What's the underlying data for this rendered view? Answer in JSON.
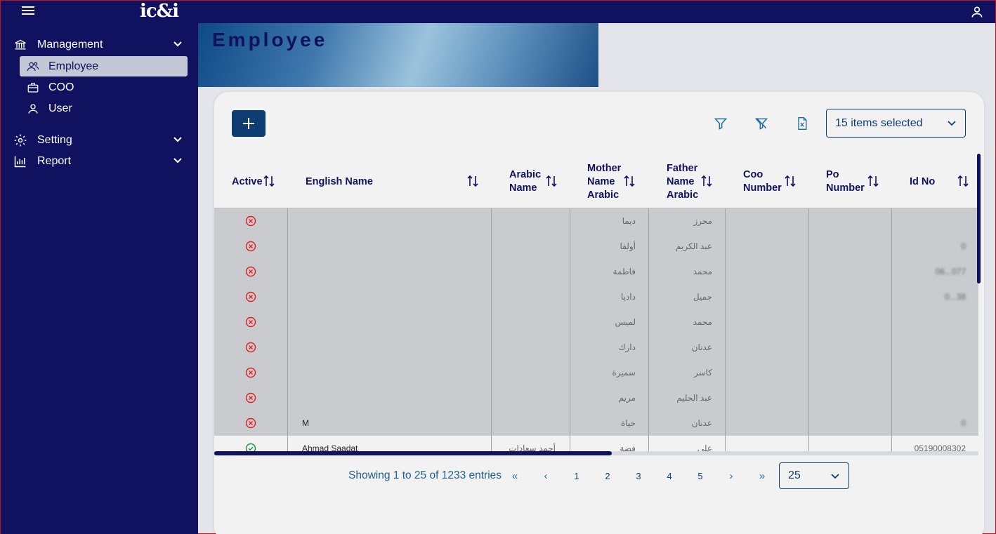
{
  "app": {
    "logo": "ic&i"
  },
  "sidebar": {
    "groups": [
      {
        "label": "Management",
        "items": [
          {
            "label": "Employee",
            "active": true
          },
          {
            "label": "COO"
          },
          {
            "label": "User"
          }
        ]
      },
      {
        "label": "Setting"
      },
      {
        "label": "Report"
      }
    ]
  },
  "page": {
    "title": "Employee"
  },
  "toolbar": {
    "columns_select": "15 items selected",
    "icons": [
      "filter-icon",
      "clear-filter-icon",
      "excel-export-icon"
    ]
  },
  "table": {
    "columns": [
      "Active",
      "English Name",
      "Arabic\nName",
      "Mother\nName\nArabic",
      "Father\nName\nArabic",
      "Coo\nNumber",
      "Po\nNumber",
      "Id No"
    ],
    "rows": [
      {
        "active": false,
        "english_name": "",
        "arabic_name": "",
        "mother": "ديما",
        "father": "محرز",
        "coo": "",
        "po": "",
        "id": ""
      },
      {
        "active": false,
        "english_name": "",
        "arabic_name": "",
        "mother": "أولفا",
        "father": "عبد الكريم",
        "coo": "",
        "po": "",
        "id": "0"
      },
      {
        "active": false,
        "english_name": "",
        "arabic_name": "",
        "mother": "فاطمة",
        "father": "محمد",
        "coo": "",
        "po": "",
        "id": "06...077"
      },
      {
        "active": false,
        "english_name": "",
        "arabic_name": "",
        "mother": "داديا",
        "father": "جميل",
        "coo": "",
        "po": "",
        "id": "0...38"
      },
      {
        "active": false,
        "english_name": "",
        "arabic_name": "",
        "mother": "لميس",
        "father": "محمد",
        "coo": "",
        "po": "",
        "id": ""
      },
      {
        "active": false,
        "english_name": "",
        "arabic_name": "",
        "mother": "دارك",
        "father": "عدنان",
        "coo": "",
        "po": "",
        "id": ""
      },
      {
        "active": false,
        "english_name": "",
        "arabic_name": "",
        "mother": "سميرة",
        "father": "كاسر",
        "coo": "",
        "po": "",
        "id": ""
      },
      {
        "active": false,
        "english_name": "",
        "arabic_name": "",
        "mother": "مريم",
        "father": "عبد الحليم",
        "coo": "",
        "po": "",
        "id": ""
      },
      {
        "active": false,
        "english_name": "M",
        "arabic_name": "",
        "mother": "حياة",
        "father": "عدنان",
        "coo": "",
        "po": "",
        "id": "0"
      },
      {
        "active": true,
        "english_name": "Ahmad Saadat",
        "arabic_name": "أحمد سعادات",
        "mother": "فضة",
        "father": "علي",
        "coo": "",
        "po": "",
        "id": "05190008302"
      }
    ]
  },
  "pagination": {
    "summary": "Showing 1 to 25 of 1233 entries",
    "first": "«",
    "prev": "‹",
    "pages": [
      "1",
      "2",
      "3",
      "4",
      "5"
    ],
    "next": "›",
    "last": "»",
    "page_size": "25"
  },
  "colors": {
    "navy": "#10115f",
    "accent": "#0e3d74",
    "inactive": "#e02020",
    "active": "#1e8f3a"
  }
}
